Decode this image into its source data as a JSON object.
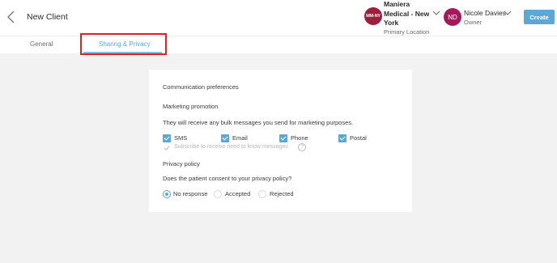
{
  "header": {
    "title": "New Client",
    "location": {
      "initials": "MM-NY",
      "name": "Maniera Medical - New York",
      "subtitle": "Primary Location"
    },
    "user": {
      "initials": "ND",
      "name": "Nicole Davies",
      "role": "Owner"
    },
    "create_label": "Create"
  },
  "tabs": [
    {
      "label": "General",
      "active": false
    },
    {
      "label": "Sharing & Privacy",
      "active": true
    }
  ],
  "communication": {
    "title": "Communication preferences",
    "marketing_title": "Marketing promotion",
    "marketing_description": "They will receive any bulk messages you send for marketing purposes.",
    "channels": [
      {
        "label": "SMS",
        "checked": true
      },
      {
        "label": "Email",
        "checked": true
      },
      {
        "label": "Phone",
        "checked": true
      },
      {
        "label": "Postal",
        "checked": true
      }
    ],
    "subscribe_label": "Subscribe to receive need to know messages",
    "privacy_title": "Privacy policy",
    "privacy_question": "Does the patient consent to your privacy policy?",
    "privacy_options": [
      {
        "label": "No response",
        "selected": true
      },
      {
        "label": "Accepted",
        "selected": false
      },
      {
        "label": "Rejected",
        "selected": false
      }
    ]
  },
  "colors": {
    "accent": "#5ba8d5",
    "location_avatar": "#9c1f3c",
    "user_avatar": "#a51a5c",
    "highlight_box": "#e02020",
    "background": "#f2f2f3"
  }
}
